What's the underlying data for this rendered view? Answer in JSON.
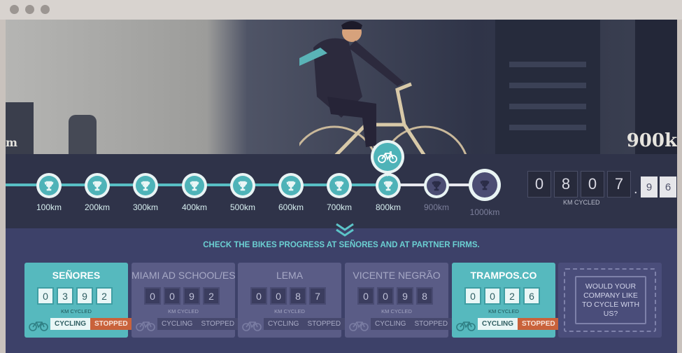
{
  "hero": {
    "distance_sign": "900k",
    "sign_left": "m"
  },
  "progress": {
    "milestones": [
      {
        "label": "100km",
        "reached": true
      },
      {
        "label": "200km",
        "reached": true
      },
      {
        "label": "300km",
        "reached": true
      },
      {
        "label": "400km",
        "reached": true
      },
      {
        "label": "500km",
        "reached": true
      },
      {
        "label": "600km",
        "reached": true
      },
      {
        "label": "700km",
        "reached": true
      },
      {
        "label": "800km",
        "reached": true
      },
      {
        "label": "900km",
        "reached": false
      },
      {
        "label": "1000km",
        "reached": false
      }
    ],
    "odometer": {
      "digits": [
        "0",
        "8",
        "0",
        "7"
      ],
      "decimals": [
        "9",
        "6"
      ],
      "separator": ".",
      "caption": "KM CYCLED"
    }
  },
  "partners": {
    "prompt": "CHECK THE BIKES PROGRESS AT SEÑORES AND AT PARTNER FIRMS.",
    "cards": [
      {
        "name": "SEÑORES",
        "digits": [
          "0",
          "3",
          "9",
          "2"
        ],
        "caption": "KM CYCLED",
        "cycling_label": "CYCLING",
        "stopped_label": "STOPPED",
        "active": true
      },
      {
        "name": "MIAMI AD SCHOOL/ESPM",
        "digits": [
          "0",
          "0",
          "9",
          "2"
        ],
        "caption": "KM CYCLED",
        "cycling_label": "CYCLING",
        "stopped_label": "STOPPED",
        "active": false
      },
      {
        "name": "LEMA",
        "digits": [
          "0",
          "0",
          "8",
          "7"
        ],
        "caption": "KM CYCLED",
        "cycling_label": "CYCLING",
        "stopped_label": "STOPPED",
        "active": false
      },
      {
        "name": "VICENTE NEGRÃO",
        "digits": [
          "0",
          "0",
          "9",
          "8"
        ],
        "caption": "KM CYCLED",
        "cycling_label": "CYCLING",
        "stopped_label": "STOPPED",
        "active": false
      },
      {
        "name": "TRAMPOS.CO",
        "digits": [
          "0",
          "0",
          "2",
          "6"
        ],
        "caption": "KM CYCLED",
        "cycling_label": "CYCLING",
        "stopped_label": "STOPPED",
        "active": true
      }
    ],
    "cta": "WOULD YOUR COMPANY LIKE TO CYCLE WITH US?"
  },
  "colors": {
    "teal": "#56b9be",
    "stopped": "#c9623b",
    "band": "#2f3349",
    "section": "#3d4169"
  }
}
